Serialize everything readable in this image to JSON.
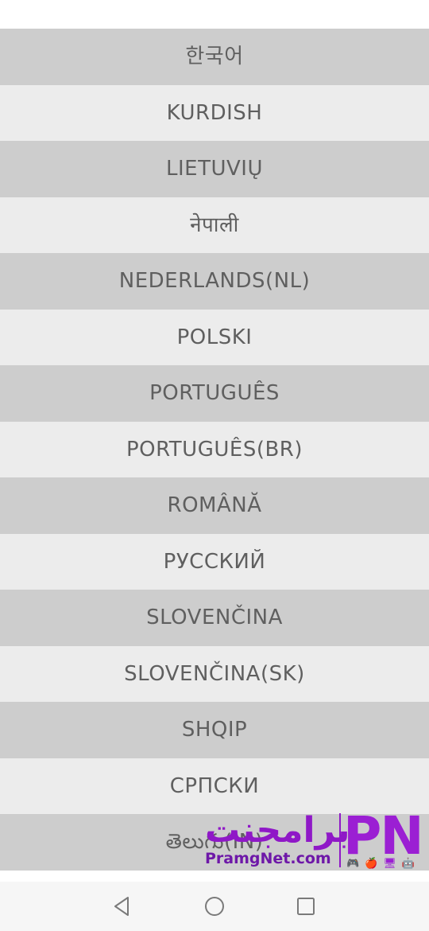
{
  "languages": [
    "한국어",
    "KURDISH",
    "LIETUVIŲ",
    "नेपाली",
    "NEDERLANDS(NL)",
    "POLSKI",
    "PORTUGUÊS",
    "PORTUGUÊS(BR)",
    "ROMÂNĂ",
    "РУССКИЙ",
    "SLOVENČINA",
    "SLOVENČINA(SK)",
    "SHQIP",
    "СРПСКИ",
    "తెలుగు(IN)"
  ],
  "watermark": {
    "arabic": "برامجنت",
    "site": "PramgNet.com",
    "logo": "PN",
    "icons": "🎮🍎🖥🤖"
  },
  "colors": {
    "row_dark": "#cdcdcd",
    "row_light": "#ececec",
    "text": "#5f5f5f",
    "watermark": "#9b1fd3"
  },
  "navbar": {
    "back_icon": "back-triangle-icon",
    "home_icon": "home-circle-icon",
    "recent_icon": "recent-square-icon"
  }
}
